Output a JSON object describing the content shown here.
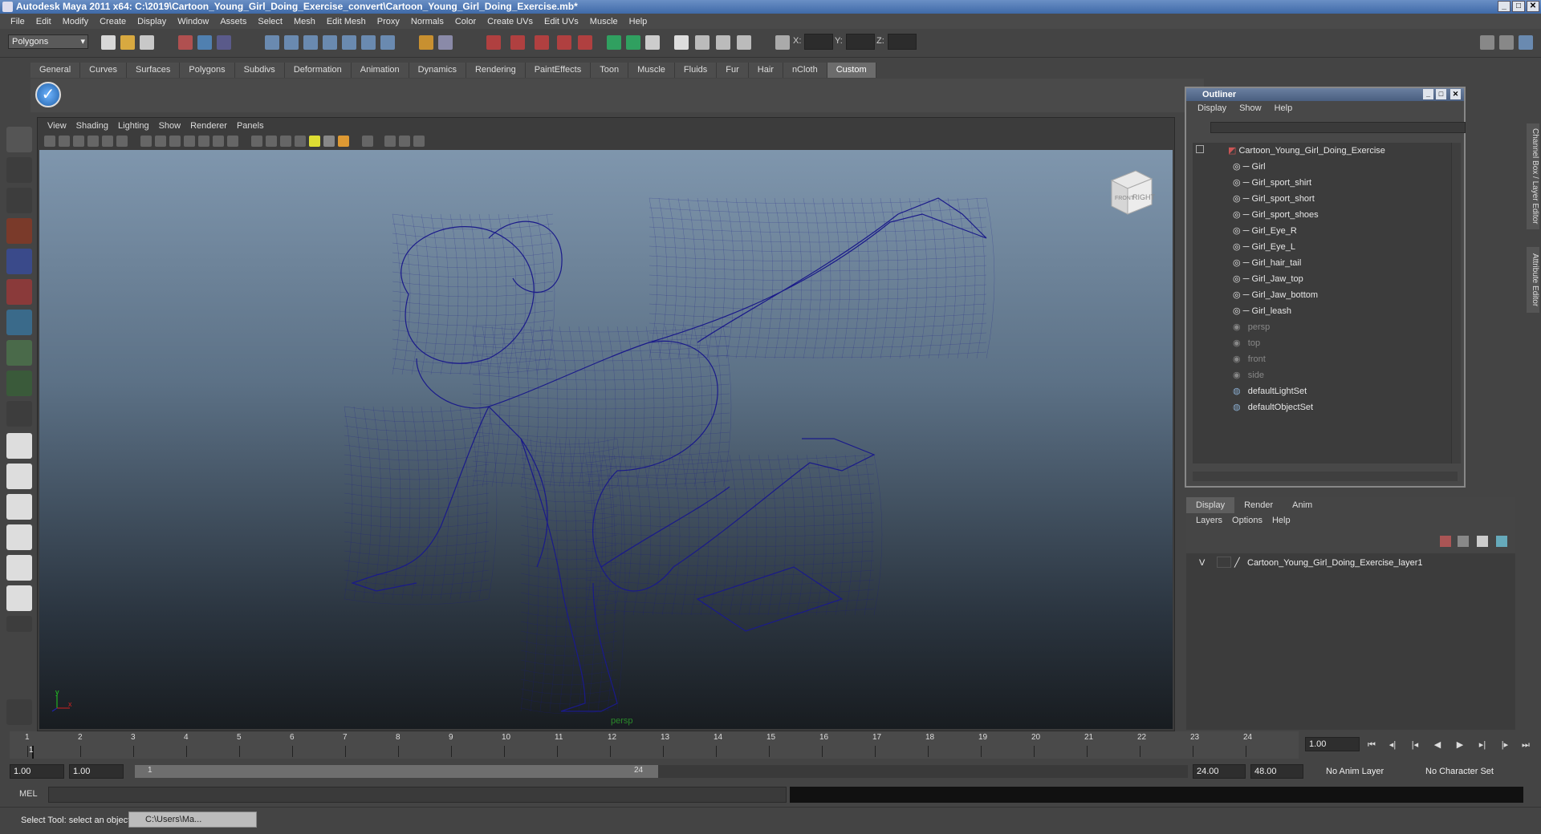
{
  "window": {
    "title": "Autodesk Maya 2011 x64: C:\\2019\\Cartoon_Young_Girl_Doing_Exercise_convert\\Cartoon_Young_Girl_Doing_Exercise.mb*"
  },
  "menubar": [
    "File",
    "Edit",
    "Modify",
    "Create",
    "Display",
    "Window",
    "Assets",
    "Select",
    "Mesh",
    "Edit Mesh",
    "Proxy",
    "Normals",
    "Color",
    "Create UVs",
    "Edit UVs",
    "Muscle",
    "Help"
  ],
  "status": {
    "mode": "Polygons",
    "x_label": "X:",
    "y_label": "Y:",
    "z_label": "Z:"
  },
  "shelf_tabs": [
    "General",
    "Curves",
    "Surfaces",
    "Polygons",
    "Subdivs",
    "Deformation",
    "Animation",
    "Dynamics",
    "Rendering",
    "PaintEffects",
    "Toon",
    "Muscle",
    "Fluids",
    "Fur",
    "Hair",
    "nCloth",
    "Custom"
  ],
  "shelf_active": "Custom",
  "viewport": {
    "menu": [
      "View",
      "Shading",
      "Lighting",
      "Show",
      "Renderer",
      "Panels"
    ],
    "camera": "persp",
    "viewcube_front": "FRONT",
    "viewcube_right": "RIGHT",
    "wire_color": "#1a1a8a"
  },
  "outliner": {
    "title": "Outliner",
    "menu": [
      "Display",
      "Show",
      "Help"
    ],
    "root": "Cartoon_Young_Girl_Doing_Exercise",
    "children": [
      "Girl",
      "Girl_sport_shirt",
      "Girl_sport_short",
      "Girl_sport_shoes",
      "Girl_Eye_R",
      "Girl_Eye_L",
      "Girl_hair_tail",
      "Girl_Jaw_top",
      "Girl_Jaw_bottom",
      "Girl_leash"
    ],
    "cameras": [
      "persp",
      "top",
      "front",
      "side"
    ],
    "sets": [
      "defaultLightSet",
      "defaultObjectSet"
    ]
  },
  "layer_editor": {
    "tabs": [
      "Display",
      "Render",
      "Anim"
    ],
    "menu": [
      "Layers",
      "Options",
      "Help"
    ],
    "layer_visible": "V",
    "layer_name": "Cartoon_Young_Girl_Doing_Exercise_layer1"
  },
  "side_tabs": [
    "Channel Box / Layer Editor",
    "Attribute Editor"
  ],
  "timeline": {
    "ticks": [
      "1",
      "2",
      "3",
      "4",
      "5",
      "6",
      "7",
      "8",
      "9",
      "10",
      "11",
      "12",
      "13",
      "14",
      "15",
      "16",
      "17",
      "18",
      "19",
      "20",
      "21",
      "22",
      "23",
      "24"
    ],
    "current_marker": "1",
    "current_frame": "1.00"
  },
  "range": {
    "start": "1.00",
    "playback_start": "1.00",
    "slider_start": "1",
    "slider_end": "24",
    "playback_end": "24.00",
    "end": "48.00",
    "anim_layer": "No Anim Layer",
    "character_set": "No Character Set"
  },
  "command": {
    "label": "MEL"
  },
  "help": {
    "text": "Select Tool: select an object",
    "task": "C:\\Users\\Ma..."
  }
}
